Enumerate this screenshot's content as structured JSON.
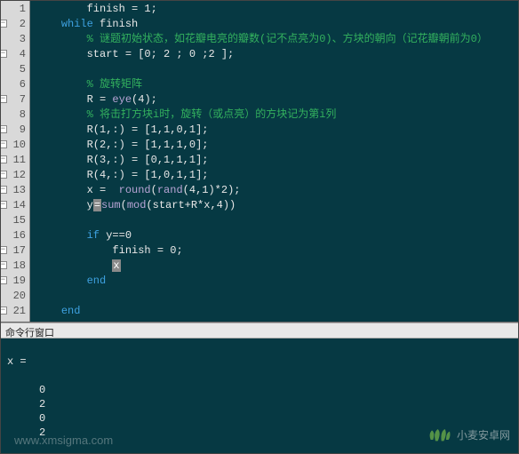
{
  "editor": {
    "lines": [
      {
        "num": 1,
        "indent": 2,
        "fold": null,
        "segments": [
          {
            "t": "finish = ",
            "c": "op"
          },
          {
            "t": "1",
            "c": "num"
          },
          {
            "t": ";",
            "c": "op"
          }
        ]
      },
      {
        "num": 2,
        "indent": 1,
        "fold": "-",
        "segments": [
          {
            "t": "while ",
            "c": "kw"
          },
          {
            "t": "finish",
            "c": "op"
          }
        ]
      },
      {
        "num": 3,
        "indent": 2,
        "fold": null,
        "segments": [
          {
            "t": "% 谜题初始状态，如花瓣电亮的瓣数(记不点亮为0)、方块的朝向（记花瓣朝前为0）",
            "c": "cm"
          }
        ]
      },
      {
        "num": 4,
        "indent": 2,
        "fold": "-",
        "segments": [
          {
            "t": "start = [",
            "c": "op"
          },
          {
            "t": "0",
            "c": "num"
          },
          {
            "t": "; ",
            "c": "op"
          },
          {
            "t": "2",
            "c": "num"
          },
          {
            "t": " ; ",
            "c": "op"
          },
          {
            "t": "0",
            "c": "num"
          },
          {
            "t": " ;",
            "c": "op"
          },
          {
            "t": "2",
            "c": "num"
          },
          {
            "t": " ];",
            "c": "op"
          }
        ]
      },
      {
        "num": 5,
        "indent": 2,
        "fold": null,
        "segments": []
      },
      {
        "num": 6,
        "indent": 2,
        "fold": null,
        "segments": [
          {
            "t": "% 旋转矩阵",
            "c": "cm"
          }
        ]
      },
      {
        "num": 7,
        "indent": 2,
        "fold": "-",
        "segments": [
          {
            "t": "R = ",
            "c": "op"
          },
          {
            "t": "eye",
            "c": "fn"
          },
          {
            "t": "(",
            "c": "op"
          },
          {
            "t": "4",
            "c": "num"
          },
          {
            "t": ");",
            "c": "op"
          }
        ]
      },
      {
        "num": 8,
        "indent": 2,
        "fold": null,
        "segments": [
          {
            "t": "% 将击打方块i时，旋转（或点亮）的方块记为第i列",
            "c": "cm"
          }
        ]
      },
      {
        "num": 9,
        "indent": 2,
        "fold": "-",
        "segments": [
          {
            "t": "R(",
            "c": "op"
          },
          {
            "t": "1",
            "c": "num"
          },
          {
            "t": ",:) = [",
            "c": "op"
          },
          {
            "t": "1",
            "c": "num"
          },
          {
            "t": ",",
            "c": "op"
          },
          {
            "t": "1",
            "c": "num"
          },
          {
            "t": ",",
            "c": "op"
          },
          {
            "t": "0",
            "c": "num"
          },
          {
            "t": ",",
            "c": "op"
          },
          {
            "t": "1",
            "c": "num"
          },
          {
            "t": "];",
            "c": "op"
          }
        ]
      },
      {
        "num": 10,
        "indent": 2,
        "fold": "-",
        "segments": [
          {
            "t": "R(",
            "c": "op"
          },
          {
            "t": "2",
            "c": "num"
          },
          {
            "t": ",:) = [",
            "c": "op"
          },
          {
            "t": "1",
            "c": "num"
          },
          {
            "t": ",",
            "c": "op"
          },
          {
            "t": "1",
            "c": "num"
          },
          {
            "t": ",",
            "c": "op"
          },
          {
            "t": "1",
            "c": "num"
          },
          {
            "t": ",",
            "c": "op"
          },
          {
            "t": "0",
            "c": "num"
          },
          {
            "t": "];",
            "c": "op"
          }
        ]
      },
      {
        "num": 11,
        "indent": 2,
        "fold": "-",
        "segments": [
          {
            "t": "R(",
            "c": "op"
          },
          {
            "t": "3",
            "c": "num"
          },
          {
            "t": ",:) = [",
            "c": "op"
          },
          {
            "t": "0",
            "c": "num"
          },
          {
            "t": ",",
            "c": "op"
          },
          {
            "t": "1",
            "c": "num"
          },
          {
            "t": ",",
            "c": "op"
          },
          {
            "t": "1",
            "c": "num"
          },
          {
            "t": ",",
            "c": "op"
          },
          {
            "t": "1",
            "c": "num"
          },
          {
            "t": "];",
            "c": "op"
          }
        ]
      },
      {
        "num": 12,
        "indent": 2,
        "fold": "-",
        "segments": [
          {
            "t": "R(",
            "c": "op"
          },
          {
            "t": "4",
            "c": "num"
          },
          {
            "t": ",:) = [",
            "c": "op"
          },
          {
            "t": "1",
            "c": "num"
          },
          {
            "t": ",",
            "c": "op"
          },
          {
            "t": "0",
            "c": "num"
          },
          {
            "t": ",",
            "c": "op"
          },
          {
            "t": "1",
            "c": "num"
          },
          {
            "t": ",",
            "c": "op"
          },
          {
            "t": "1",
            "c": "num"
          },
          {
            "t": "];",
            "c": "op"
          }
        ]
      },
      {
        "num": 13,
        "indent": 2,
        "fold": "-",
        "segments": [
          {
            "t": "x =  ",
            "c": "op"
          },
          {
            "t": "round",
            "c": "fn"
          },
          {
            "t": "(",
            "c": "op"
          },
          {
            "t": "rand",
            "c": "fn"
          },
          {
            "t": "(",
            "c": "op"
          },
          {
            "t": "4",
            "c": "num"
          },
          {
            "t": ",",
            "c": "op"
          },
          {
            "t": "1",
            "c": "num"
          },
          {
            "t": ")*",
            "c": "op"
          },
          {
            "t": "2",
            "c": "num"
          },
          {
            "t": ");",
            "c": "op"
          }
        ]
      },
      {
        "num": 14,
        "indent": 2,
        "fold": "-",
        "segments": [
          {
            "t": "y",
            "c": "op"
          },
          {
            "t": "=",
            "c": "hl"
          },
          {
            "t": "sum",
            "c": "fn"
          },
          {
            "t": "(",
            "c": "op"
          },
          {
            "t": "mod",
            "c": "fn"
          },
          {
            "t": "(start+R*x,",
            "c": "op"
          },
          {
            "t": "4",
            "c": "num"
          },
          {
            "t": "))",
            "c": "op"
          }
        ]
      },
      {
        "num": 15,
        "indent": 2,
        "fold": null,
        "segments": []
      },
      {
        "num": 16,
        "indent": 2,
        "fold": null,
        "segments": [
          {
            "t": "if ",
            "c": "kw"
          },
          {
            "t": "y==",
            "c": "op"
          },
          {
            "t": "0",
            "c": "num"
          }
        ]
      },
      {
        "num": 17,
        "indent": 3,
        "fold": "-",
        "segments": [
          {
            "t": "finish = ",
            "c": "op"
          },
          {
            "t": "0",
            "c": "num"
          },
          {
            "t": ";",
            "c": "op"
          }
        ]
      },
      {
        "num": 18,
        "indent": 3,
        "fold": "-",
        "segments": [
          {
            "t": "x",
            "c": "hl"
          }
        ]
      },
      {
        "num": 19,
        "indent": 2,
        "fold": "-",
        "segments": [
          {
            "t": "end",
            "c": "kw"
          }
        ]
      },
      {
        "num": 20,
        "indent": 2,
        "fold": null,
        "segments": []
      },
      {
        "num": 21,
        "indent": 1,
        "fold": "-",
        "segments": [
          {
            "t": "end",
            "c": "kw"
          }
        ]
      }
    ]
  },
  "command_window": {
    "title": "命令行窗口",
    "output_header": "x =",
    "output_values": [
      "0",
      "2",
      "0",
      "2"
    ]
  },
  "watermarks": {
    "left": "www.xmsigma.com",
    "right": "小麦安卓网"
  }
}
